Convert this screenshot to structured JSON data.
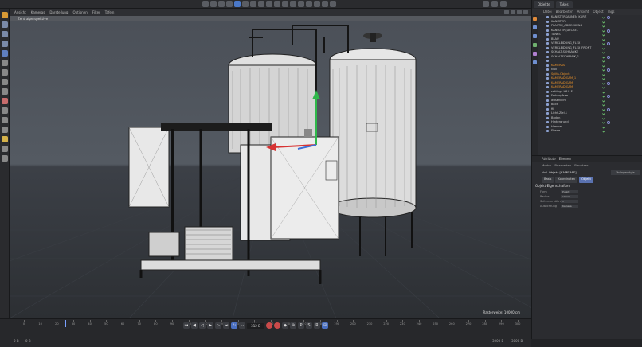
{
  "viewport_menu": [
    "Ansicht",
    "Kameras",
    "Darstellung",
    "Optionen",
    "Filter",
    "Tafeln"
  ],
  "viewport_title": "Zentralperspektive",
  "scale_label": "Rasterweite: 10000 cm",
  "right_tabs": [
    "Objekte",
    "Takes"
  ],
  "right_menu": [
    "Datei",
    "Bearbeiten",
    "Ansicht",
    "Objekt",
    "Tags"
  ],
  "objects": [
    {
      "name": "KANISTERKARNEN_KURZ",
      "orange": false
    },
    {
      "name": "KANISTER",
      "orange": false
    },
    {
      "name": "PLASTIK_ABDECKUNG",
      "orange": false
    },
    {
      "name": "KANISTER_DECKEL",
      "orange": false
    },
    {
      "name": "TANKS",
      "orange": false
    },
    {
      "name": "BLAU",
      "orange": false
    },
    {
      "name": "VERKLEIDUNG_FLEX",
      "orange": false
    },
    {
      "name": "VERKLEIDUNG_FLEX_FRONT",
      "orange": false
    },
    {
      "name": "SCHALT-SCHRÄNKE",
      "orange": false
    },
    {
      "name": "SCHALTSCHRANK_1",
      "orange": false
    },
    {
      "name": "",
      "orange": false
    },
    {
      "name": "KAMERAS",
      "orange": true
    },
    {
      "name": "Null",
      "orange": false
    },
    {
      "name": "Splits.Object",
      "orange": true
    },
    {
      "name": "KAMERADIGAM_1",
      "orange": true
    },
    {
      "name": "KAMERADIGAM",
      "orange": true
    },
    {
      "name": "KAMERADIGAM",
      "orange": true
    },
    {
      "name": "settings HALLE",
      "orange": false
    },
    {
      "name": "Farbtopfsee",
      "orange": false
    },
    {
      "name": "außenlicht",
      "orange": false
    },
    {
      "name": "back",
      "orange": false
    },
    {
      "name": "fill",
      "orange": false
    },
    {
      "name": "Licht-Ziel.1",
      "orange": false
    },
    {
      "name": "Boden",
      "orange": false
    },
    {
      "name": "Hintergrund",
      "orange": false
    },
    {
      "name": "Himmel",
      "orange": false
    },
    {
      "name": "Ebene",
      "orange": false
    }
  ],
  "attr_tabs": [
    "Attribute",
    "Ebenen"
  ],
  "attr_menu": [
    "Modus",
    "Bearbeiten",
    "Benutzer"
  ],
  "attr_object": "Null-Objekt [KAMERAS]",
  "attr_preset": "Vorlagenstyle",
  "attr_subtabs": [
    "Basis",
    "Koordinaten",
    "Objekt"
  ],
  "attr_section": "Objekt-Eigenschaften",
  "attr_fields": [
    {
      "label": "Form",
      "value": "Punkt"
    },
    {
      "label": "Radius",
      "value": "10 cm"
    },
    {
      "label": "Seitenverhältnis",
      "value": "1"
    },
    {
      "label": "Ausrichtung",
      "value": "Kamera"
    }
  ],
  "ruler_labels": [
    "0",
    "10",
    "20",
    "30",
    "40",
    "50",
    "60",
    "70",
    "80",
    "90",
    "100",
    "110",
    "120",
    "130",
    "140",
    "150",
    "160",
    "170",
    "180",
    "190",
    "200",
    "210",
    "220",
    "230",
    "240",
    "250",
    "260",
    "270",
    "280",
    "290",
    "300"
  ],
  "current_frame": "312 B",
  "start_frame": "0 B",
  "end_frame_a": "3000 B",
  "end_frame_b": "3000 B",
  "frame_left": "0 B"
}
